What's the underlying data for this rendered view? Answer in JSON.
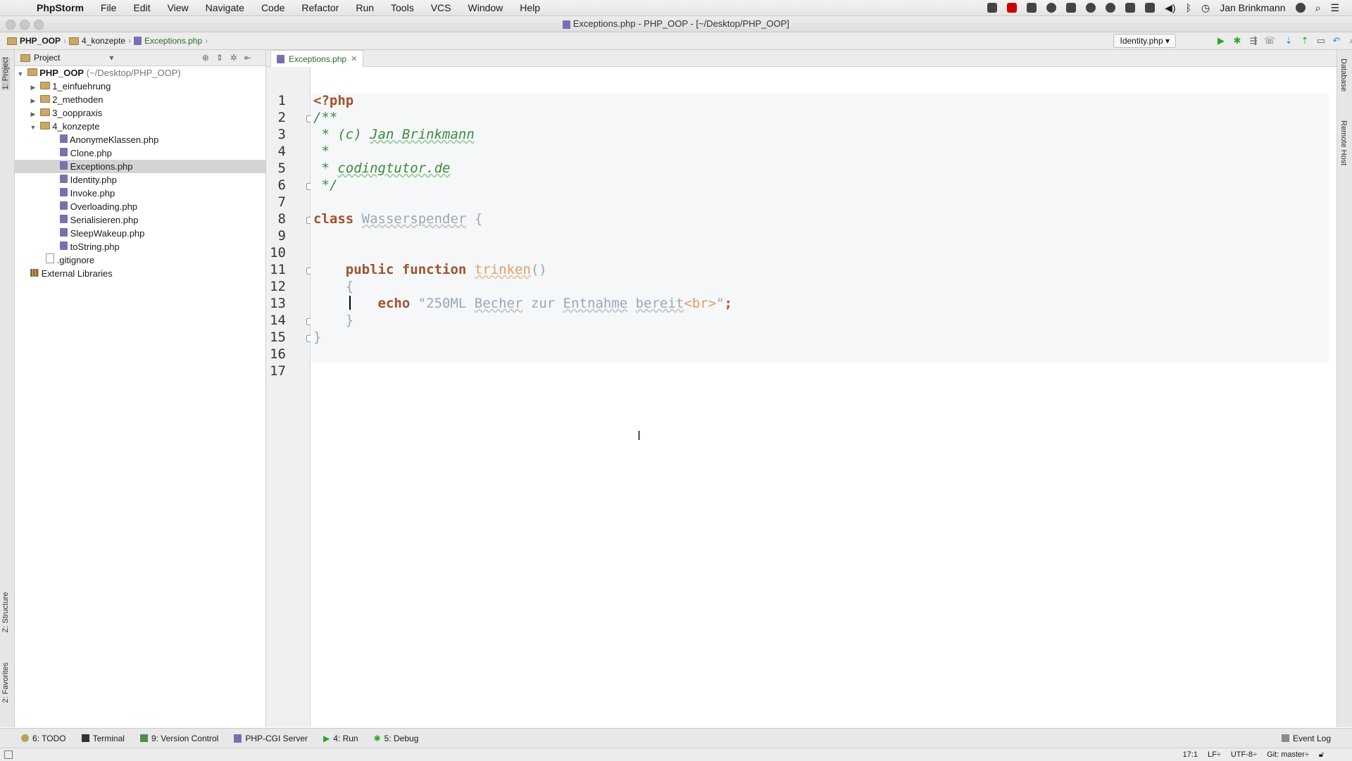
{
  "menubar": {
    "app": "PhpStorm",
    "items": [
      "File",
      "Edit",
      "View",
      "Navigate",
      "Code",
      "Refactor",
      "Run",
      "Tools",
      "VCS",
      "Window",
      "Help"
    ],
    "user": "Jan Brinkmann"
  },
  "window": {
    "title": "Exceptions.php - PHP_OOP - [~/Desktop/PHP_OOP]"
  },
  "breadcrumb": [
    "PHP_OOP",
    "4_konzepte",
    "Exceptions.php"
  ],
  "toolbar": {
    "run_config": "Identity.php ▾"
  },
  "left_strip": {
    "project": "1: Project",
    "structure": "Z: Structure",
    "favorites": "2: Favorites"
  },
  "right_strip": {
    "database": "Database",
    "remote_host": "Remote Host"
  },
  "project_panel": {
    "header": "Project",
    "root": {
      "name": "PHP_OOP",
      "path": "(~/Desktop/PHP_OOP)"
    },
    "folders_collapsed": [
      "1_einfuehrung",
      "2_methoden",
      "3_ooppraxis"
    ],
    "open_folder": "4_konzepte",
    "files": [
      "AnonymeKlassen.php",
      "Clone.php",
      "Exceptions.php",
      "Identity.php",
      "Invoke.php",
      "Overloading.php",
      "Serialisieren.php",
      "SleepWakeup.php",
      "toString.php"
    ],
    "selected_file": "Exceptions.php",
    "gitignore": ".gitignore",
    "external": "External Libraries"
  },
  "editor": {
    "tab": "Exceptions.php",
    "line_numbers": [
      "1",
      "2",
      "3",
      "4",
      "5",
      "6",
      "7",
      "8",
      "9",
      "10",
      "11",
      "12",
      "13",
      "14",
      "15",
      "16",
      "17"
    ],
    "code": {
      "l1": "<?php",
      "l2": "/**",
      "l3a": " * (c) ",
      "l3b": "Jan Brinkmann",
      "l4": " *",
      "l5a": " * ",
      "l5b": "codingtutor.de",
      "l6": " */",
      "l8a": "class",
      "l8b": "Wasserspender",
      "l8c": " {",
      "l11a": "    public function ",
      "l11b": "trinken",
      "l11c": "()",
      "l12": "    {",
      "l13a": "        echo ",
      "l13b": "\"250ML ",
      "l13c": "Becher",
      "l13d": " zur ",
      "l13e": "Entnahme",
      "l13f": " ",
      "l13g": "bereit",
      "l13h": "<br>",
      "l13i": "\"",
      "l13j": ";",
      "l14": "    }",
      "l15": "}"
    }
  },
  "bottom_tools": [
    "6: TODO",
    "Terminal",
    "9: Version Control",
    "PHP-CGI Server",
    "4: Run",
    "5: Debug"
  ],
  "event_log": "Event Log",
  "status": {
    "position": "17:1",
    "line_sep": "LF÷",
    "encoding": "UTF-8÷",
    "git": "Git: master÷"
  }
}
